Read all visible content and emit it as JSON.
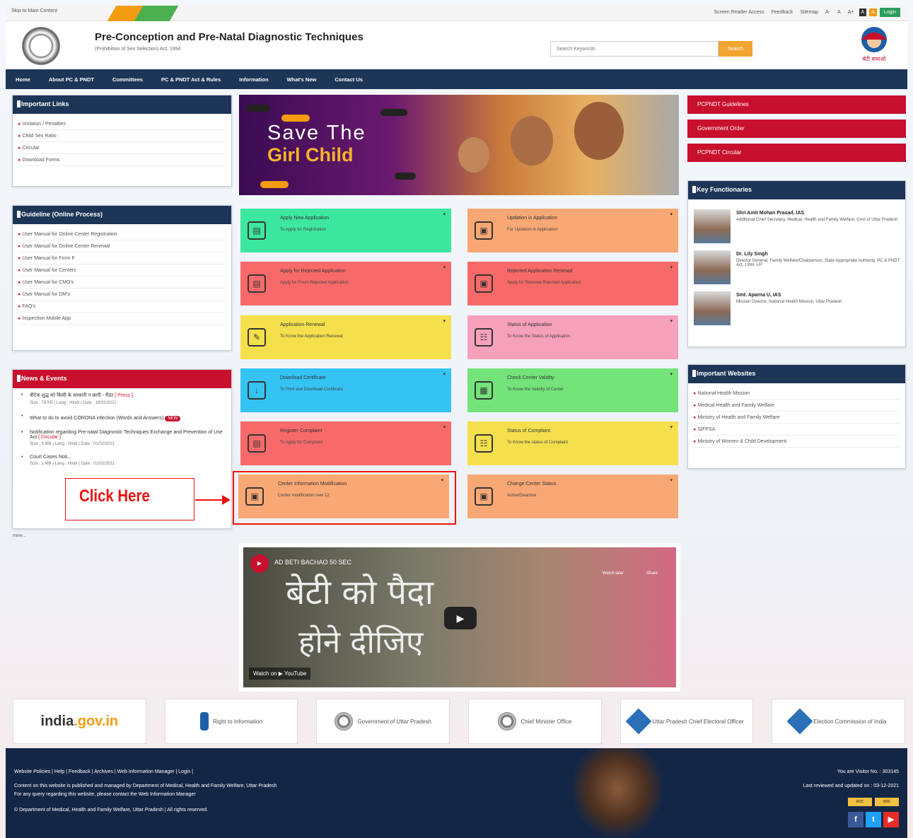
{
  "topbar": {
    "skip": "Skip to Main Content",
    "links": [
      "Screen Reader Access",
      "Feedback",
      "Sitemap",
      "A-",
      "A",
      "A+",
      "A",
      "A",
      "A"
    ],
    "login": "Login"
  },
  "header": {
    "title": "Pre-Conception and Pre-Natal Diagnostic Techniques",
    "subtitle": "(Prohibition of Sex Selection) Act, 1994",
    "search_placeholder": "Search Keywords",
    "search_button": "Search",
    "logo_text": "बेटी बचाओ"
  },
  "nav": [
    "Home",
    "About PC & PNDT",
    "Committees",
    "PC & PNDT Act & Rules",
    "Information",
    "What's New",
    "Contact Us"
  ],
  "important_links": {
    "title": "Important Links",
    "items": [
      "Violation / Penalties",
      "Child Sex Ratio",
      "Circular",
      "Download Forms"
    ]
  },
  "guideline": {
    "title": "Guideline (Online Process)",
    "items": [
      "User Manual for Online Center Registration",
      "User Manual for Online Center Renewal",
      "User Manual for Form F",
      "User Manual for Centers",
      "User Manual for CMO's",
      "User Manual for DM's",
      "FAQ's",
      "Inspection Mobile App"
    ]
  },
  "news": {
    "title": "News & Events",
    "items": [
      {
        "text": "बीटेक शुद्ध को किसी के सरकारी न छापी - रीडर",
        "link": "[ Press ]",
        "meta": "Size : 78 KB | Lang : Hindi | Date : 19/02/2021"
      },
      {
        "text": "What to do to avoid CORONA infection",
        "link": "(Words and Answers)",
        "meta": "NEW"
      },
      {
        "text": "Notification regarding Pre-natal Diagnostic Techniques Exchange and Prevention of Use Act",
        "link": "[ Circular ]",
        "meta": "Size : 8 MB | Lang : Hindi | Date : 01/02/2021"
      },
      {
        "text": "Court Cases Noti...",
        "link": "",
        "meta": "Size : 1 MB | Lang : Hindi | Date : 01/02/2021"
      }
    ],
    "more": "more..."
  },
  "banner": {
    "line1": "Save The",
    "line2": "Girl Child"
  },
  "tiles": [
    {
      "title": "Apply New Application",
      "sub": "To Apply for Registration",
      "color": "t-green",
      "icon": "form-icon"
    },
    {
      "title": "Updation in Application",
      "sub": "For Updation in Application",
      "color": "t-orange",
      "icon": "clipboard-icon"
    },
    {
      "title": "Apply for Rejected Application",
      "sub": "Apply for Fresh Rejected Application",
      "color": "t-red",
      "icon": "form-icon"
    },
    {
      "title": "Rejected Application Renewal",
      "sub": "Apply for Renewal Rejected Application",
      "color": "t-red",
      "icon": "clipboard-icon"
    },
    {
      "title": "Application Renewal",
      "sub": "To Know the Application Renewal",
      "color": "t-yellow",
      "icon": "edit-icon"
    },
    {
      "title": "Status of Application",
      "sub": "To Know the Status of Application",
      "color": "t-pink",
      "icon": "status-icon"
    },
    {
      "title": "Download Certificate",
      "sub": "To Print and Download Certificate",
      "color": "t-blue",
      "icon": "download-icon"
    },
    {
      "title": "Check Center Validity",
      "sub": "To Know the Validity of Center",
      "color": "t-lgreen",
      "icon": "calendar-icon"
    },
    {
      "title": "Register Complaint",
      "sub": "To Apply for Complaint",
      "color": "t-red",
      "icon": "form-icon"
    },
    {
      "title": "Status of Complaint",
      "sub": "To Know the status of Complaint",
      "color": "t-yellow",
      "icon": "status-icon"
    },
    {
      "title": "Center Information Modification",
      "sub": "Center modification new 12",
      "color": "t-orange",
      "icon": "clipboard-icon"
    },
    {
      "title": "Change Center Status",
      "sub": "Active/Deactive",
      "color": "t-orange",
      "icon": "clipboard-icon"
    }
  ],
  "callout": {
    "text": "Click Here"
  },
  "right_links": [
    "PCPNDT Guidelines",
    "Government Order",
    "PCPNDT Circular"
  ],
  "functionaries": {
    "title": "Key Functionaries",
    "people": [
      {
        "name": "Shri Amit Mohan Prasad, IAS",
        "role": "Additional Chief Secretary, Medical, Health and Family Welfare, Govt of Uttar Pradesh"
      },
      {
        "name": "Dr. Lily Singh",
        "role": "Director General, Family Welfare/Chairperson, State Appropriate Authority, PC & PNDT Act, 1994, UP"
      },
      {
        "name": "Smt. Aparna U, IAS",
        "role": "Mission Director, National Health Mission, Uttar Pradesh"
      }
    ]
  },
  "websites": {
    "title": "Important Websites",
    "items": [
      "National Health Mission",
      "Medical Health and Family Welfare",
      "Ministry of Health and Family Welfare",
      "SIFPSA",
      "Ministry of Women & Child Development"
    ]
  },
  "video": {
    "title": "AD BETI BACHAO 50 SEC",
    "hindi1": "बेटी को पैदा",
    "hindi2": "होने दीजिए",
    "watch_on": "Watch on ▶ YouTube",
    "watch_later": "Watch later",
    "share": "Share"
  },
  "partners": {
    "india_gov_a": "india",
    "india_gov_b": ".gov.in",
    "rti": "Right to Information",
    "up": "Government of Uttar Pradesh",
    "chief": "Chief Minister Office",
    "ceo": "Uttar Pradesh Chief Electoral Officer",
    "eci": "Election Commission of India"
  },
  "footer": {
    "links": "Website Policies | Help | Feedback | Archives | Web Information Manager | Login |",
    "line1": "Content on this website is published and managed by Department of Medical, Health and Family Welfare, Uttar Pradesh",
    "line2": "For any query regarding this website, please contact the Web Information Manager",
    "line3": "© Department of Medical, Health and Family Welfare, Uttar Pradesh | All rights reserved.",
    "visitor": "You are Visitor No. : 303145",
    "updated": "Last reviewed and updated on : 03-12-2021"
  }
}
